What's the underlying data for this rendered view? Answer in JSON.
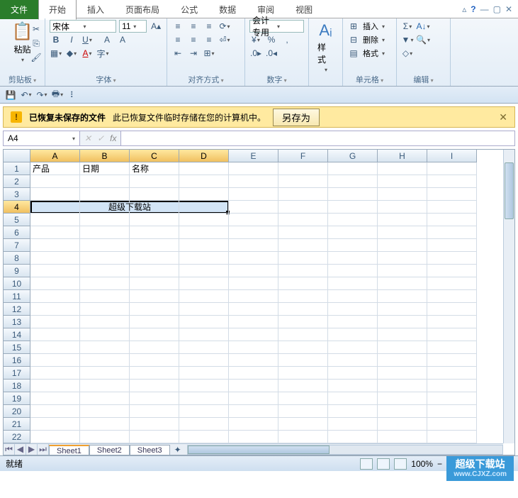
{
  "tabs": {
    "file": "文件",
    "active": "开始",
    "items": [
      "插入",
      "页面布局",
      "公式",
      "数据",
      "审阅",
      "视图"
    ]
  },
  "ribbon": {
    "clipboard": {
      "label": "剪贴板",
      "paste": "粘贴"
    },
    "font": {
      "label": "字体",
      "name": "宋体",
      "size": "11"
    },
    "align": {
      "label": "对齐方式"
    },
    "number": {
      "label": "数字",
      "format": "会计专用"
    },
    "styles": {
      "label": "样式",
      "btn": "样式"
    },
    "cells": {
      "label": "单元格",
      "insert": "插入",
      "delete": "删除",
      "format": "格式"
    },
    "editing": {
      "label": "编辑"
    }
  },
  "warn": {
    "title": "已恢复未保存的文件",
    "msg": "此已恢复文件临时存储在您的计算机中。",
    "btn": "另存为"
  },
  "namebox": "A4",
  "cols": [
    "A",
    "B",
    "C",
    "D",
    "E",
    "F",
    "G",
    "H",
    "I"
  ],
  "selCols": [
    "A",
    "B",
    "C",
    "D"
  ],
  "selRow": 4,
  "rowCount": 22,
  "cells": {
    "A1": "产品",
    "B1": "日期",
    "C1": "名称",
    "merged": "超级下载站"
  },
  "sheets": {
    "active": "Sheet1",
    "others": [
      "Sheet2",
      "Sheet3"
    ]
  },
  "status": {
    "ready": "就绪",
    "zoom": "100%"
  },
  "wm": {
    "t": "超级下载站",
    "u": "www.CJXZ.com"
  }
}
